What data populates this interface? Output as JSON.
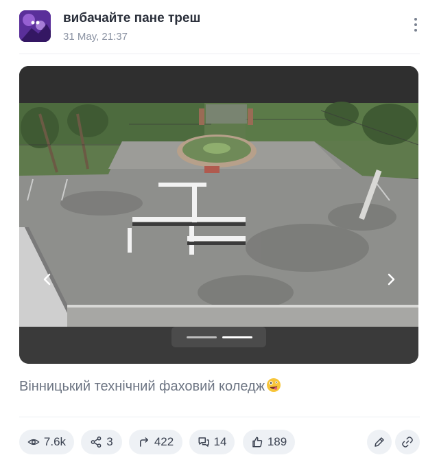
{
  "post": {
    "author": "вибачайте пане треш",
    "date": "31 May, 21:37",
    "caption": "Вінницький технічний фаховий коледж"
  },
  "gallery": {
    "slides_total": 2,
    "active_slide": 2
  },
  "stats": {
    "views": "7.6k",
    "shares": "3",
    "reposts": "422",
    "comments": "14",
    "likes": "189"
  },
  "icons": {
    "menu": "more-vertical-icon",
    "prev": "chevron-left-icon",
    "next": "chevron-right-icon",
    "views": "eye-icon",
    "shares": "share-icon",
    "reposts": "repost-arrow-icon",
    "comments": "comments-icon",
    "likes": "thumbs-up-icon",
    "edit": "pencil-icon",
    "link": "link-icon",
    "emoji": "zany-face-emoji"
  },
  "colors": {
    "accent": "#5b6475",
    "pill_bg": "#eef1f5",
    "muted": "#8b93a3"
  }
}
